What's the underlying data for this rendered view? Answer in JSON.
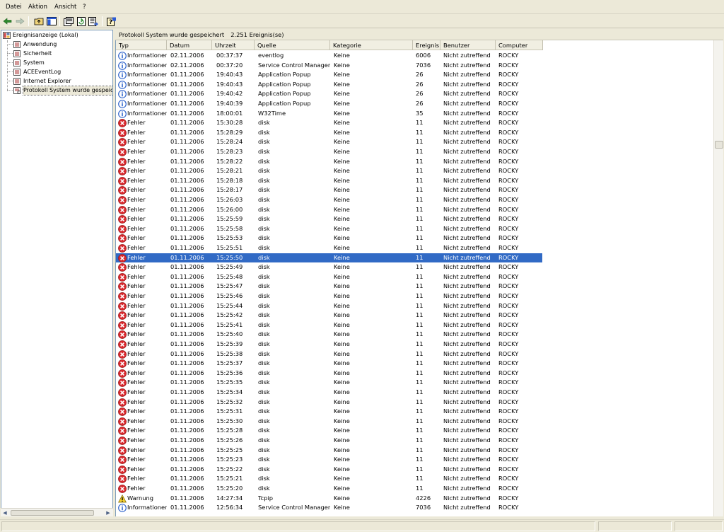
{
  "menu": [
    "Datei",
    "Aktion",
    "Ansicht",
    "?"
  ],
  "toolbar": [
    "back-icon",
    "forward-icon",
    "up-folder-icon",
    "show-hide-tree-icon",
    "properties-icon",
    "refresh-icon",
    "export-list-icon",
    "help-icon"
  ],
  "tree": {
    "root": "Ereignisanzeige (Lokal)",
    "items": [
      "Anwendung",
      "Sicherheit",
      "System",
      "ACEEventLog",
      "Internet Explorer",
      "Protokoll System wurde gespeich"
    ]
  },
  "panel": {
    "title": "Protokoll System wurde gespeichert",
    "count": "2.251 Ereignis(se)"
  },
  "columns": [
    "Typ",
    "Datum",
    "Uhrzeit",
    "Quelle",
    "Kategorie",
    "Ereignis",
    "Benutzer",
    "Computer"
  ],
  "rows": [
    [
      "info",
      "Informationen",
      "02.11.2006",
      "00:37:37",
      "eventlog",
      "Keine",
      "6006",
      "Nicht zutreffend",
      "ROCKY"
    ],
    [
      "info",
      "Informationen",
      "02.11.2006",
      "00:37:20",
      "Service Control Manager",
      "Keine",
      "7036",
      "Nicht zutreffend",
      "ROCKY"
    ],
    [
      "info",
      "Informationen",
      "01.11.2006",
      "19:40:43",
      "Application Popup",
      "Keine",
      "26",
      "Nicht zutreffend",
      "ROCKY"
    ],
    [
      "info",
      "Informationen",
      "01.11.2006",
      "19:40:43",
      "Application Popup",
      "Keine",
      "26",
      "Nicht zutreffend",
      "ROCKY"
    ],
    [
      "info",
      "Informationen",
      "01.11.2006",
      "19:40:42",
      "Application Popup",
      "Keine",
      "26",
      "Nicht zutreffend",
      "ROCKY"
    ],
    [
      "info",
      "Informationen",
      "01.11.2006",
      "19:40:39",
      "Application Popup",
      "Keine",
      "26",
      "Nicht zutreffend",
      "ROCKY"
    ],
    [
      "info",
      "Informationen",
      "01.11.2006",
      "18:00:01",
      "W32Time",
      "Keine",
      "35",
      "Nicht zutreffend",
      "ROCKY"
    ],
    [
      "error",
      "Fehler",
      "01.11.2006",
      "15:30:28",
      "disk",
      "Keine",
      "11",
      "Nicht zutreffend",
      "ROCKY"
    ],
    [
      "error",
      "Fehler",
      "01.11.2006",
      "15:28:29",
      "disk",
      "Keine",
      "11",
      "Nicht zutreffend",
      "ROCKY"
    ],
    [
      "error",
      "Fehler",
      "01.11.2006",
      "15:28:24",
      "disk",
      "Keine",
      "11",
      "Nicht zutreffend",
      "ROCKY"
    ],
    [
      "error",
      "Fehler",
      "01.11.2006",
      "15:28:23",
      "disk",
      "Keine",
      "11",
      "Nicht zutreffend",
      "ROCKY"
    ],
    [
      "error",
      "Fehler",
      "01.11.2006",
      "15:28:22",
      "disk",
      "Keine",
      "11",
      "Nicht zutreffend",
      "ROCKY"
    ],
    [
      "error",
      "Fehler",
      "01.11.2006",
      "15:28:21",
      "disk",
      "Keine",
      "11",
      "Nicht zutreffend",
      "ROCKY"
    ],
    [
      "error",
      "Fehler",
      "01.11.2006",
      "15:28:18",
      "disk",
      "Keine",
      "11",
      "Nicht zutreffend",
      "ROCKY"
    ],
    [
      "error",
      "Fehler",
      "01.11.2006",
      "15:28:17",
      "disk",
      "Keine",
      "11",
      "Nicht zutreffend",
      "ROCKY"
    ],
    [
      "error",
      "Fehler",
      "01.11.2006",
      "15:26:03",
      "disk",
      "Keine",
      "11",
      "Nicht zutreffend",
      "ROCKY"
    ],
    [
      "error",
      "Fehler",
      "01.11.2006",
      "15:26:00",
      "disk",
      "Keine",
      "11",
      "Nicht zutreffend",
      "ROCKY"
    ],
    [
      "error",
      "Fehler",
      "01.11.2006",
      "15:25:59",
      "disk",
      "Keine",
      "11",
      "Nicht zutreffend",
      "ROCKY"
    ],
    [
      "error",
      "Fehler",
      "01.11.2006",
      "15:25:58",
      "disk",
      "Keine",
      "11",
      "Nicht zutreffend",
      "ROCKY"
    ],
    [
      "error",
      "Fehler",
      "01.11.2006",
      "15:25:53",
      "disk",
      "Keine",
      "11",
      "Nicht zutreffend",
      "ROCKY"
    ],
    [
      "error",
      "Fehler",
      "01.11.2006",
      "15:25:51",
      "disk",
      "Keine",
      "11",
      "Nicht zutreffend",
      "ROCKY"
    ],
    [
      "error",
      "Fehler",
      "01.11.2006",
      "15:25:50",
      "disk",
      "Keine",
      "11",
      "Nicht zutreffend",
      "ROCKY"
    ],
    [
      "error",
      "Fehler",
      "01.11.2006",
      "15:25:49",
      "disk",
      "Keine",
      "11",
      "Nicht zutreffend",
      "ROCKY"
    ],
    [
      "error",
      "Fehler",
      "01.11.2006",
      "15:25:48",
      "disk",
      "Keine",
      "11",
      "Nicht zutreffend",
      "ROCKY"
    ],
    [
      "error",
      "Fehler",
      "01.11.2006",
      "15:25:47",
      "disk",
      "Keine",
      "11",
      "Nicht zutreffend",
      "ROCKY"
    ],
    [
      "error",
      "Fehler",
      "01.11.2006",
      "15:25:46",
      "disk",
      "Keine",
      "11",
      "Nicht zutreffend",
      "ROCKY"
    ],
    [
      "error",
      "Fehler",
      "01.11.2006",
      "15:25:44",
      "disk",
      "Keine",
      "11",
      "Nicht zutreffend",
      "ROCKY"
    ],
    [
      "error",
      "Fehler",
      "01.11.2006",
      "15:25:42",
      "disk",
      "Keine",
      "11",
      "Nicht zutreffend",
      "ROCKY"
    ],
    [
      "error",
      "Fehler",
      "01.11.2006",
      "15:25:41",
      "disk",
      "Keine",
      "11",
      "Nicht zutreffend",
      "ROCKY"
    ],
    [
      "error",
      "Fehler",
      "01.11.2006",
      "15:25:40",
      "disk",
      "Keine",
      "11",
      "Nicht zutreffend",
      "ROCKY"
    ],
    [
      "error",
      "Fehler",
      "01.11.2006",
      "15:25:39",
      "disk",
      "Keine",
      "11",
      "Nicht zutreffend",
      "ROCKY"
    ],
    [
      "error",
      "Fehler",
      "01.11.2006",
      "15:25:38",
      "disk",
      "Keine",
      "11",
      "Nicht zutreffend",
      "ROCKY"
    ],
    [
      "error",
      "Fehler",
      "01.11.2006",
      "15:25:37",
      "disk",
      "Keine",
      "11",
      "Nicht zutreffend",
      "ROCKY"
    ],
    [
      "error",
      "Fehler",
      "01.11.2006",
      "15:25:36",
      "disk",
      "Keine",
      "11",
      "Nicht zutreffend",
      "ROCKY"
    ],
    [
      "error",
      "Fehler",
      "01.11.2006",
      "15:25:35",
      "disk",
      "Keine",
      "11",
      "Nicht zutreffend",
      "ROCKY"
    ],
    [
      "error",
      "Fehler",
      "01.11.2006",
      "15:25:34",
      "disk",
      "Keine",
      "11",
      "Nicht zutreffend",
      "ROCKY"
    ],
    [
      "error",
      "Fehler",
      "01.11.2006",
      "15:25:32",
      "disk",
      "Keine",
      "11",
      "Nicht zutreffend",
      "ROCKY"
    ],
    [
      "error",
      "Fehler",
      "01.11.2006",
      "15:25:31",
      "disk",
      "Keine",
      "11",
      "Nicht zutreffend",
      "ROCKY"
    ],
    [
      "error",
      "Fehler",
      "01.11.2006",
      "15:25:30",
      "disk",
      "Keine",
      "11",
      "Nicht zutreffend",
      "ROCKY"
    ],
    [
      "error",
      "Fehler",
      "01.11.2006",
      "15:25:28",
      "disk",
      "Keine",
      "11",
      "Nicht zutreffend",
      "ROCKY"
    ],
    [
      "error",
      "Fehler",
      "01.11.2006",
      "15:25:26",
      "disk",
      "Keine",
      "11",
      "Nicht zutreffend",
      "ROCKY"
    ],
    [
      "error",
      "Fehler",
      "01.11.2006",
      "15:25:25",
      "disk",
      "Keine",
      "11",
      "Nicht zutreffend",
      "ROCKY"
    ],
    [
      "error",
      "Fehler",
      "01.11.2006",
      "15:25:23",
      "disk",
      "Keine",
      "11",
      "Nicht zutreffend",
      "ROCKY"
    ],
    [
      "error",
      "Fehler",
      "01.11.2006",
      "15:25:22",
      "disk",
      "Keine",
      "11",
      "Nicht zutreffend",
      "ROCKY"
    ],
    [
      "error",
      "Fehler",
      "01.11.2006",
      "15:25:21",
      "disk",
      "Keine",
      "11",
      "Nicht zutreffend",
      "ROCKY"
    ],
    [
      "error",
      "Fehler",
      "01.11.2006",
      "15:25:20",
      "disk",
      "Keine",
      "11",
      "Nicht zutreffend",
      "ROCKY"
    ],
    [
      "warn",
      "Warnung",
      "01.11.2006",
      "14:27:34",
      "Tcpip",
      "Keine",
      "4226",
      "Nicht zutreffend",
      "ROCKY"
    ],
    [
      "info",
      "Informationen",
      "01.11.2006",
      "12:56:34",
      "Service Control Manager",
      "Keine",
      "7036",
      "Nicht zutreffend",
      "ROCKY"
    ]
  ],
  "selected_row": 21,
  "colors": {
    "selection": "#316ac5",
    "error_icon": "#d8282d",
    "info_icon": "#3266cc",
    "warning_icon": "#f6d232"
  }
}
